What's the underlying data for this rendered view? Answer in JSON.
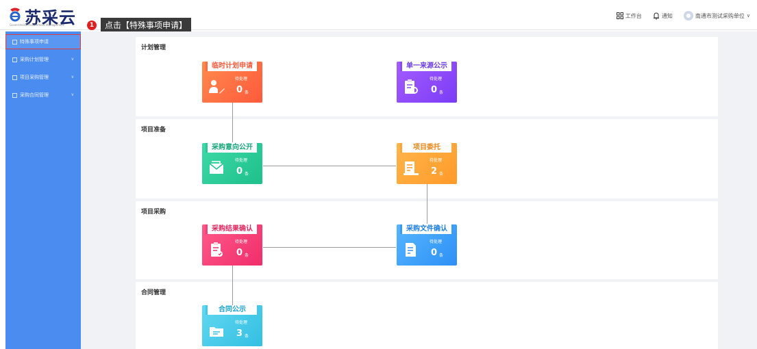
{
  "header": {
    "logo_text": "苏采云",
    "logo_subtitle": "Government Procurement Management",
    "tooltip_badge": "1",
    "tooltip_text": "点击【特殊事项申请】",
    "workbench_label": "工作台",
    "notice_label": "通知",
    "org_name": "南通市测试采购单位",
    "icons": {
      "workbench": "grid-icon",
      "notice": "bell-icon",
      "avatar": "user-avatar-icon",
      "dropdown": "chevron-down-icon"
    }
  },
  "sidebar": {
    "items": [
      {
        "label": "特殊事项申请",
        "active": true,
        "expandable": false
      },
      {
        "label": "采购计划管理",
        "active": false,
        "expandable": true
      },
      {
        "label": "项目采购管理",
        "active": false,
        "expandable": true
      },
      {
        "label": "采购合同管理",
        "active": false,
        "expandable": true
      }
    ]
  },
  "sections": [
    {
      "title": "计划管理"
    },
    {
      "title": "项目准备"
    },
    {
      "title": "项目采购"
    },
    {
      "title": "合同管理"
    }
  ],
  "cards": {
    "temp_plan": {
      "title": "临时计划申请",
      "status": "待处理",
      "count": "0",
      "unit": "条",
      "icon": "person-edit-icon",
      "color": "#ff5a3c"
    },
    "single_source": {
      "title": "单一来源公示",
      "status": "待处理",
      "count": "0",
      "unit": "条",
      "icon": "clipboard-search-icon",
      "color": "#7a3cf5"
    },
    "intent_publish": {
      "title": "采购意向公开",
      "status": "待处理",
      "count": "0",
      "unit": "条",
      "icon": "envelope-icon",
      "color": "#1ec08b"
    },
    "project_entrust": {
      "title": "项目委托",
      "status": "待处理",
      "count": "2",
      "unit": "条",
      "icon": "document-list-icon",
      "color": "#ff9a2a"
    },
    "result_confirm": {
      "title": "采购结果确认",
      "status": "待处理",
      "count": "0",
      "unit": "条",
      "icon": "clipboard-check-icon",
      "color": "#f02d6a"
    },
    "file_confirm": {
      "title": "采购文件确认",
      "status": "待处理",
      "count": "0",
      "unit": "条",
      "icon": "document-edit-icon",
      "color": "#2e90f5"
    },
    "contract_publish": {
      "title": "合同公示",
      "status": "待处理",
      "count": "3",
      "unit": "条",
      "icon": "folder-icon",
      "color": "#33bfe3"
    }
  }
}
